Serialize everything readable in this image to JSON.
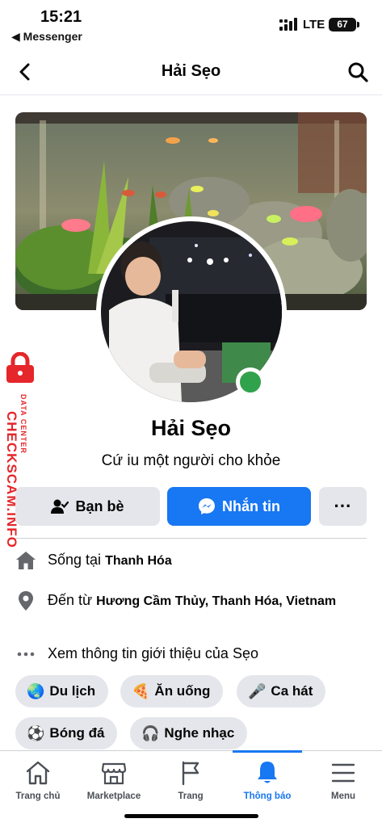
{
  "status_bar": {
    "time": "15:21",
    "back_app": "◀ Messenger",
    "network": "LTE",
    "battery": "67"
  },
  "header": {
    "title": "Hải Sẹo"
  },
  "watermark": {
    "main": "CHECKSCAM.INFO",
    "sub": "DATA CENTER"
  },
  "profile": {
    "name": "Hải Sẹo",
    "bio": "Cứ iu một người cho khỏe",
    "online": true
  },
  "actions": {
    "friends_label": "Bạn bè",
    "message_label": "Nhắn tin",
    "more_label": "···"
  },
  "intro": {
    "lives_prefix": "Sống tại ",
    "lives_place": "Thanh Hóa",
    "from_prefix": "Đến từ ",
    "from_place": "Hương Cầm Thủy, Thanh Hóa, Vietnam",
    "see_more": "Xem thông tin giới thiệu của Sẹo"
  },
  "hobbies": [
    {
      "emoji": "🌏",
      "label": "Du lịch"
    },
    {
      "emoji": "🍕",
      "label": "Ăn uống"
    },
    {
      "emoji": "🎤",
      "label": "Ca hát"
    },
    {
      "emoji": "⚽",
      "label": "Bóng đá"
    },
    {
      "emoji": "🎧",
      "label": "Nghe nhạc"
    }
  ],
  "tabs": [
    {
      "label": "Trang chủ",
      "icon": "home-icon"
    },
    {
      "label": "Marketplace",
      "icon": "marketplace-icon"
    },
    {
      "label": "Trang",
      "icon": "flag-icon"
    },
    {
      "label": "Thông báo",
      "icon": "bell-icon",
      "active": true
    },
    {
      "label": "Menu",
      "icon": "menu-icon"
    }
  ],
  "colors": {
    "accent": "#1877f2",
    "online": "#31a24c",
    "watermark": "#e5262a",
    "chip_bg": "#e4e6eb"
  }
}
